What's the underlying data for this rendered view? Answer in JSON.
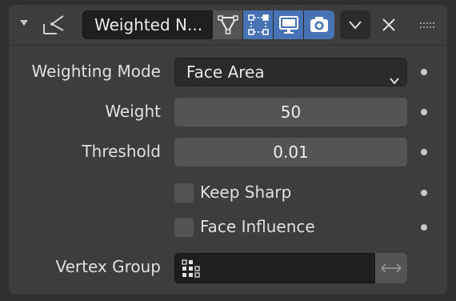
{
  "header": {
    "collapse_icon": "triangle-down-icon",
    "modifier_icon": "weighted-normal-modifier-icon",
    "name": "Weighted N...",
    "toggles": [
      {
        "icon": "edit-mode-cage-icon",
        "active": false
      },
      {
        "icon": "edit-mode-icon",
        "active": true
      },
      {
        "icon": "realtime-viewport-icon",
        "active": true
      },
      {
        "icon": "render-camera-icon",
        "active": true
      }
    ],
    "dropdown_icon": "chevron-down-icon",
    "close_icon": "close-icon",
    "drag_icon": "drag-handle-icon"
  },
  "properties": {
    "weighting_mode": {
      "label": "Weighting Mode",
      "value": "Face Area"
    },
    "weight": {
      "label": "Weight",
      "value": "50"
    },
    "threshold": {
      "label": "Threshold",
      "value": "0.01"
    },
    "keep_sharp": {
      "label": "Keep Sharp",
      "checked": false
    },
    "face_influence": {
      "label": "Face Influence",
      "checked": false
    },
    "vertex_group": {
      "label": "Vertex Group",
      "value": "",
      "icon": "vertex-group-icon",
      "invert_icon": "arrow-left-right-icon"
    }
  },
  "colors": {
    "background": "#303030",
    "panel": "#3d3d3d",
    "active_toggle": "#4772b3",
    "field_dark": "#2b2b2b",
    "field_number": "#545454"
  }
}
